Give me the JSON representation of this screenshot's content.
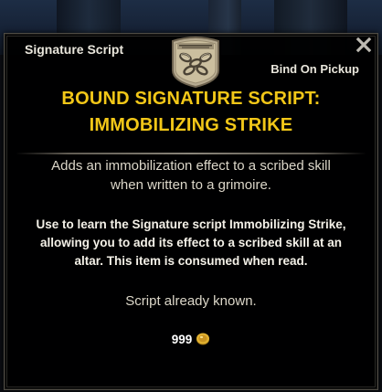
{
  "tooltip": {
    "item_type": "Signature Script",
    "bind_type": "Bind On Pickup",
    "title": "BOUND SIGNATURE SCRIPT:\nIMMOBILIZING STRIKE",
    "description": "Adds an immobilization effect to a scribed skill\nwhen written to a grimoire.",
    "use_text": "Use to learn the Signature script Immobilizing Strike,\nallowing you to add its effect to a scribed skill at an\naltar. This item is consumed when read.",
    "status": "Script already known.",
    "value": "999",
    "icons": {
      "item_icon": "scroll-seal-icon",
      "currency_icon": "gold-coin-icon",
      "close_icon": "close-icon"
    },
    "colors": {
      "title": "#f2c718",
      "body": "#dcd7c9",
      "emphasis": "#f4f1e8",
      "gold": "#d9a520"
    }
  }
}
